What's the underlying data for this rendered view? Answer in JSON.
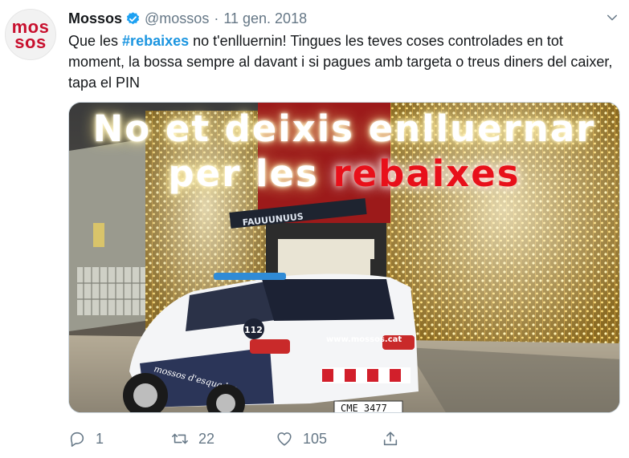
{
  "avatar": {
    "line1": "mos",
    "line2": "sos"
  },
  "header": {
    "name": "Mossos",
    "handle": "@mossos",
    "separator": "·",
    "date": "11 gen. 2018"
  },
  "tweet": {
    "text_before": "Que les ",
    "hashtag": "#rebaixes",
    "text_after": " no t'enlluernin! Tingues les teves coses controlades en tot moment, la bossa sempre al davant i si pagues amb targeta o treus diners del caixer, tapa el PIN"
  },
  "media": {
    "line1": "No et deixis enlluernar",
    "line2_prefix": "per les ",
    "line2_highlight": "rebaixes",
    "car_website": "www.mossos.cat",
    "car_label": "mossos d'esquadra",
    "car_number": "112",
    "plate": "CME 3477",
    "store_sign": "FAUUUNUUS"
  },
  "actions": {
    "replies": "1",
    "retweets": "22",
    "likes": "105"
  },
  "colors": {
    "accent": "#1b95e0",
    "muted": "#657786",
    "brand_red": "#c8102e",
    "overlay_red": "#e8101a"
  }
}
